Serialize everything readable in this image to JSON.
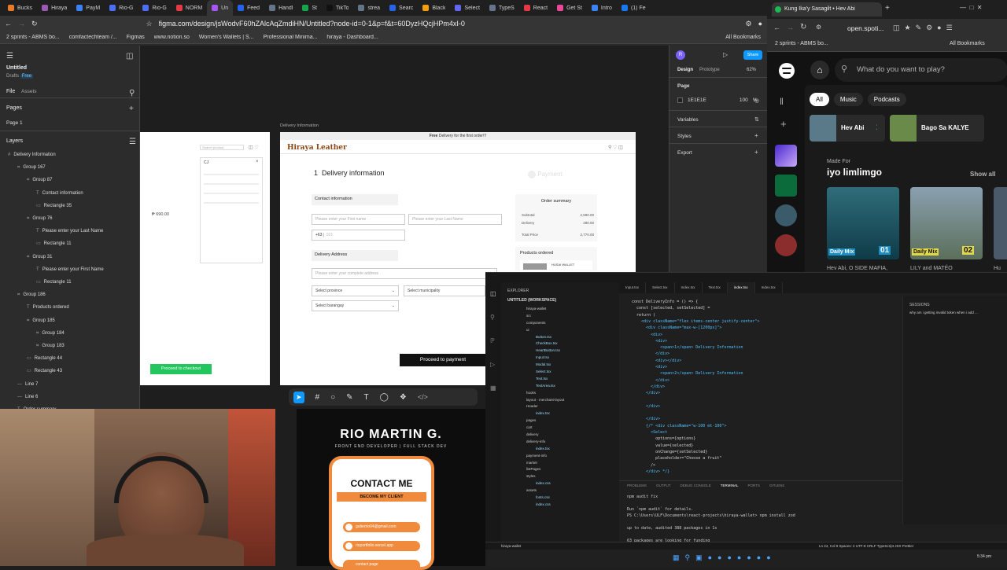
{
  "left_browser": {
    "tabs": [
      "Bucks",
      "Hiraya",
      "PayM",
      "Rio-G",
      "Rio-G",
      "NORM",
      "Un",
      "Feed",
      "Handl",
      "St",
      "TikTo",
      "strea",
      "Searc",
      "Black",
      "Select",
      "TypeS",
      "React",
      "Get St",
      "Intro",
      "(1) Fe"
    ],
    "active_tab": "Un",
    "url": "figma.com/design/jsWodvF60hZAlcAqZmdiHN/Untitled?node-id=0-1&p=f&t=60DyzHQcjHPm4xI-0",
    "bookmarks": [
      "2 sprints - ABMS bo...",
      "comfactechteam /...",
      "Figmas",
      "www.notion.so",
      "Women's Wallets | S...",
      "Professional Minima...",
      "hiraya - Dashboard..."
    ],
    "all_bookmarks": "All Bookmarks"
  },
  "figma": {
    "file_name": "Untitled",
    "drafts": "Drafts",
    "plan": "Free",
    "tab_file": "File",
    "tab_assets": "Assets",
    "pages_label": "Pages",
    "page1": "Page 1",
    "layers_label": "Layers",
    "layers": [
      {
        "name": "Delivery Information",
        "indent": 0
      },
      {
        "name": "Group 167",
        "indent": 1
      },
      {
        "name": "Group 87",
        "indent": 2
      },
      {
        "name": "Contact information",
        "indent": 3
      },
      {
        "name": "Rectangle 35",
        "indent": 3
      },
      {
        "name": "Group 76",
        "indent": 2
      },
      {
        "name": "Please enter your Last Name",
        "indent": 3
      },
      {
        "name": "Rectangle 11",
        "indent": 3
      },
      {
        "name": "Group 31",
        "indent": 2
      },
      {
        "name": "Please enter your First Name",
        "indent": 3
      },
      {
        "name": "Rectangle 11",
        "indent": 3
      },
      {
        "name": "Group 186",
        "indent": 1
      },
      {
        "name": "Products ordered",
        "indent": 2
      },
      {
        "name": "Group 185",
        "indent": 2
      },
      {
        "name": "Group 184",
        "indent": 3
      },
      {
        "name": "Group 183",
        "indent": 3
      },
      {
        "name": "Rectangle 44",
        "indent": 2
      },
      {
        "name": "Rectangle 43",
        "indent": 2
      },
      {
        "name": "Line 7",
        "indent": 1
      },
      {
        "name": "Line 6",
        "indent": 1
      },
      {
        "name": "Order summary",
        "indent": 1
      }
    ],
    "design_tab": "Design",
    "prototype_tab": "Prototype",
    "zoom": "62%",
    "share": "Share",
    "page_section": "Page",
    "page_color": "1E1E1E",
    "page_opacity": "100",
    "percent": "%",
    "variables": "Variables",
    "styles": "Styles",
    "export": "Export",
    "frame_label": "Delivery Information",
    "frame1_price": "₱ 690.00",
    "frame1_button": "Proceed to checkout",
    "frame1_search": "Search product",
    "frame1_panel_title": "CJ",
    "banner_free": "Free",
    "banner_text": "Delivery for the first order!!!",
    "brand": "Hiraya Leather",
    "step_num": "1",
    "step_title": "Delivery information",
    "step2": "Payment",
    "contact_info": "Contact information",
    "first_ph": "Please enter your First name",
    "last_ph": "Please enter your Last Name",
    "phone_prefix": "+63",
    "phone_ph": "921",
    "delivery_address": "Delivery Address",
    "address_ph": "Please enter your complete address",
    "province": "Select province",
    "municipality": "Select municipality",
    "barangay": "Select barangay",
    "proceed_payment": "Proceed to payment",
    "order_summary": "Order summary",
    "subtotal_label": "Subtotal",
    "subtotal": "2,590.00",
    "delivery_label": "Delivery",
    "delivery": "280.00",
    "total_label": "Total Price",
    "total": "2,770.00",
    "products_ordered": "Products ordered",
    "product_name": "HUSAI WALLET"
  },
  "right_browser": {
    "tab_title": "Kung Ika'y Sasagilt • Hev Abi",
    "url": "open.spoti...",
    "bookmark": "2 sprints - ABMS bo...",
    "all_bookmarks": "All Bookmarks",
    "search_ph": "What do you want to play?",
    "chips": [
      "All",
      "Music",
      "Podcasts"
    ],
    "quick1": "Hev Abi",
    "quick2": "Bago Sa KALYE",
    "made_for": "Made For",
    "user": "iyo limlimgo",
    "show_all": "Show all",
    "mix1_label": "Daily Mix",
    "mix1_num": "01",
    "mix1_sub": "Hev Abi, O SIDE MAFIA,",
    "mix2_label": "Daily Mix",
    "mix2_num": "02",
    "mix2_sub": "LILY and MATÉO",
    "mix3_sub": "Hu"
  },
  "vscode": {
    "explorer": "EXPLORER",
    "workspace": "UNTITLED (WORKSPACE)",
    "files": [
      "hiraya-wallet",
      "src",
      "components",
      "ui",
      "Button.tsx",
      "CheckBox.tsx",
      "HeartButton.tsx",
      "Input.tsx",
      "Modal.tsx",
      "Select.tsx",
      "Text.tsx",
      "TextArea.tsx",
      "hooks",
      "layout - merchant-layout",
      "Header",
      "index.tsx",
      "pages",
      "cart",
      "delivery",
      "delivery-info",
      "index.tsx",
      "payment-info",
      "market",
      "listPages",
      "styles",
      "index.css",
      "assets",
      "fonts.css",
      "index.css"
    ],
    "tabs": [
      "Input.tsx",
      "Select.tsx",
      "Index.tsx",
      "Text.tsx",
      "index.tsx",
      "Index.tsx"
    ],
    "code_lines": [
      "const DeliveryInfo = () => {",
      "  const [selected, setSelected] =",
      "  return (",
      "    <div className=\"flex items-center justify-center\">",
      "      <div className=\"max-w-[1200px]\">",
      "        <div>",
      "          <div>",
      "            <span>1</span> Delivery Information",
      "          </div>",
      "          <div></div>",
      "          <div>",
      "            <span>2</span> Delivery Information",
      "          </div>",
      "        </div>",
      "      </div>",
      "",
      "      </div>",
      "",
      "      </div>",
      "      {/* <div className=\"w-100 mt-100\">",
      "        <Select",
      "          options={options}",
      "          value={selected}",
      "          onChange={setSelected}",
      "          placeholder=\"Choose a fruit\"",
      "        />",
      "      </div> */}"
    ],
    "terminal_tabs": [
      "PROBLEMS",
      "OUTPUT",
      "DEBUG CONSOLE",
      "TERMINAL",
      "PORTS",
      "GITLENS"
    ],
    "terminal_lines": [
      "npm audit fix",
      "",
      "Run `npm audit` for details.",
      "PS C:\\Users\\ULF\\Documents\\react-projects\\hiraya-wallet> npm install zod",
      "",
      "up to date, audited 388 packages in 1s",
      "",
      "63 packages are looking for funding"
    ],
    "sessions_label": "SESSIONS",
    "status_left": "hiraya-wallet",
    "status_right": "Ln 24, Col 9   Spaces: 2   UTF-8   CRLF   TypeScript JSX   Prettier",
    "chat_text": "why am i getting invalid token when i add ...",
    "clock": "5:34 pm"
  },
  "portfolio": {
    "name": "RIO MARTIN G.",
    "subtitle": "FRONT END DEVELOPER | FULL STACK DEV",
    "contact": "CONTACT ME",
    "become": "BECOME MY CLIENT",
    "email": "gutierrio04@gmail.com",
    "site": "rioportfolio.vercel.app",
    "more": "contact page"
  },
  "colors": {
    "figma_blue": "#0d99ff",
    "green": "#22c55e",
    "spotify_green": "#1db954",
    "orange": "#f08a3c",
    "brown": "#8b4513"
  }
}
